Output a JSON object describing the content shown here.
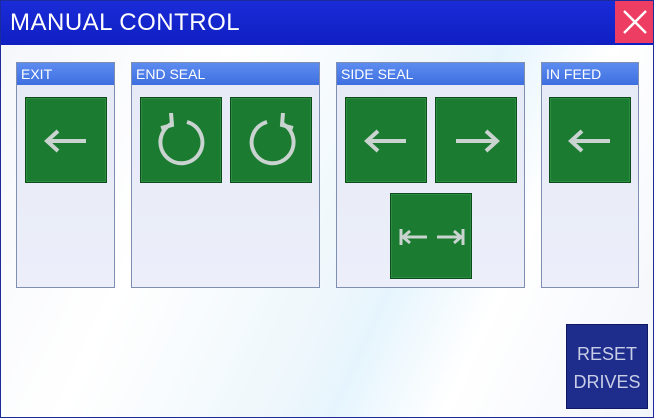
{
  "window": {
    "title": "MANUAL CONTROL"
  },
  "groups": {
    "exit": {
      "label": "EXIT"
    },
    "end_seal": {
      "label": "END SEAL"
    },
    "side_seal": {
      "label": "SIDE SEAL"
    },
    "in_feed": {
      "label": "IN FEED"
    }
  },
  "buttons": {
    "exit_reverse": {
      "icon": "arrow-left-icon"
    },
    "end_seal_cw": {
      "icon": "rotate-clockwise-icon"
    },
    "end_seal_ccw": {
      "icon": "rotate-counterclockwise-icon"
    },
    "side_seal_left": {
      "icon": "arrow-left-icon"
    },
    "side_seal_right": {
      "icon": "arrow-right-icon"
    },
    "side_seal_step": {
      "icon": "step-arrows-icon"
    },
    "in_feed_reverse": {
      "icon": "arrow-left-icon"
    }
  },
  "reset": {
    "line1": "RESET",
    "line2": "DRIVES"
  },
  "colors": {
    "titlebar": "#1428d0",
    "close": "#ee3d63",
    "group_header": "#4a7ce8",
    "button_green": "#1b7b31",
    "icon": "#c9d3cf",
    "reset": "#1e2c8c"
  }
}
